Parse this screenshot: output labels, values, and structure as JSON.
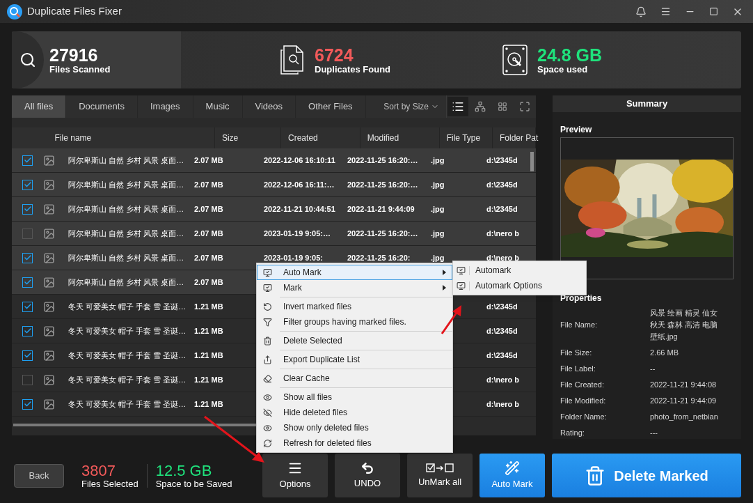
{
  "window": {
    "title": "Duplicate Files Fixer"
  },
  "stats": [
    {
      "kind": "scanned",
      "value": "27916",
      "label": "Files Scanned"
    },
    {
      "kind": "duplicates",
      "value": "6724",
      "label": "Duplicates Found"
    },
    {
      "kind": "space",
      "value": "24.8 GB",
      "label": "Space used"
    }
  ],
  "tabs": [
    {
      "label": "All files",
      "selected": true
    },
    {
      "label": "Documents",
      "selected": false
    },
    {
      "label": "Images",
      "selected": false
    },
    {
      "label": "Music",
      "selected": false
    },
    {
      "label": "Videos",
      "selected": false
    },
    {
      "label": "Other Files",
      "selected": false
    }
  ],
  "sort": {
    "label": "Sort by Size"
  },
  "view_modes": [
    {
      "kind": "list",
      "selected": true
    },
    {
      "kind": "tree",
      "selected": false
    },
    {
      "kind": "grid",
      "selected": false
    },
    {
      "kind": "expand",
      "selected": false
    }
  ],
  "table": {
    "columns": [
      "File name",
      "Size",
      "Created",
      "Modified",
      "File Type",
      "Folder Pat"
    ],
    "rows": [
      {
        "checked": true,
        "highlighted": true,
        "name": "阿尔卑斯山 自然 乡村 风景 桌面…",
        "size": "2.07 MB",
        "created": "2022-12-06 16:10:11",
        "modified": "2022-11-25 16:20:…",
        "type": ".jpg",
        "folder": "d:\\2345d"
      },
      {
        "checked": true,
        "highlighted": true,
        "name": "阿尔卑斯山 自然 乡村 风景 桌面…",
        "size": "2.07 MB",
        "created": "2022-12-06 16:11:…",
        "modified": "2022-11-25 16:20:…",
        "type": ".jpg",
        "folder": "d:\\2345d"
      },
      {
        "checked": true,
        "highlighted": true,
        "name": "阿尔卑斯山 自然 乡村 风景 桌面…",
        "size": "2.07 MB",
        "created": "2022-11-21 10:44:51",
        "modified": "2022-11-21 9:44:09",
        "type": ".jpg",
        "folder": "d:\\2345d"
      },
      {
        "checked": false,
        "highlighted": true,
        "name": "阿尔卑斯山 自然 乡村 风景 桌面…",
        "size": "2.07 MB",
        "created": "2023-01-19 9:05:…",
        "modified": "2022-11-25 16:20:…",
        "type": ".jpg",
        "folder": "d:\\nero b"
      },
      {
        "checked": true,
        "highlighted": true,
        "name": "阿尔卑斯山 自然 乡村 风景 桌面…",
        "size": "2.07 MB",
        "created": "2023-01-19 9:05:",
        "modified": "2022-11-25 16:20:",
        "type": ".jpg",
        "folder": "d:\\nero b"
      },
      {
        "checked": true,
        "highlighted": true,
        "name": "阿尔卑斯山 自然 乡村 风景 桌面…",
        "size": "2.07 MB"
      },
      {
        "checked": true,
        "highlighted": false,
        "name": "冬天 可爱美女 帽子 手套 雪 圣诞…",
        "size": "1.21 MB",
        "folder": "d:\\2345d"
      },
      {
        "checked": true,
        "highlighted": false,
        "name": "冬天 可爱美女 帽子 手套 雪 圣诞…",
        "size": "1.21 MB",
        "folder": "d:\\2345d"
      },
      {
        "checked": true,
        "highlighted": false,
        "name": "冬天 可爱美女 帽子 手套 雪 圣诞…",
        "size": "1.21 MB",
        "folder": "d:\\2345d"
      },
      {
        "checked": false,
        "highlighted": false,
        "name": "冬天 可爱美女 帽子 手套 雪 圣诞…",
        "size": "1.21 MB",
        "folder": "d:\\nero b"
      },
      {
        "checked": true,
        "highlighted": false,
        "name": "冬天 可爱美女 帽子 手套 雪 圣诞…",
        "size": "1.21 MB",
        "folder": "d:\\nero b"
      }
    ]
  },
  "summary": {
    "title": "Summary",
    "preview_label": "Preview",
    "properties_label": "Properties",
    "properties": [
      {
        "label": "File Name:",
        "value": "风景 绘画 精灵 仙女秋天 森林 高清 电脑壁纸.jpg"
      },
      {
        "label": "File Size:",
        "value": "2.66 MB"
      },
      {
        "label": "File Label:",
        "value": "--"
      },
      {
        "label": "File Created:",
        "value": "2022-11-21 9:44:08"
      },
      {
        "label": "File Modified:",
        "value": "2022-11-21 9:44:09"
      },
      {
        "label": "Folder Name:",
        "value": "photo_from_netbian"
      },
      {
        "label": "Rating:",
        "value": "---"
      }
    ]
  },
  "footer": {
    "back": "Back",
    "selected_count": "3807",
    "selected_label": "Files Selected",
    "saved_size": "12.5 GB",
    "saved_label": "Space to be Saved",
    "buttons": [
      {
        "kind": "options",
        "label": "Options"
      },
      {
        "kind": "undo",
        "label": "UNDO"
      },
      {
        "kind": "unmark",
        "label": "UnMark all"
      },
      {
        "kind": "automark",
        "label": "Auto Mark"
      },
      {
        "kind": "delete",
        "label": "Delete Marked"
      }
    ]
  },
  "context_menu": {
    "items": [
      {
        "kind": "submenu",
        "label": "Auto Mark",
        "highlighted": true
      },
      {
        "kind": "submenu",
        "label": "Mark",
        "highlighted": false
      },
      {
        "kind": "separator"
      },
      {
        "kind": "invert",
        "label": "Invert marked files",
        "highlighted": false
      },
      {
        "kind": "filter",
        "label": "Filter groups having marked files.",
        "highlighted": false
      },
      {
        "kind": "separator"
      },
      {
        "kind": "trash",
        "label": "Delete Selected",
        "highlighted": false
      },
      {
        "kind": "separator"
      },
      {
        "kind": "export",
        "label": "Export Duplicate List",
        "highlighted": false
      },
      {
        "kind": "separator"
      },
      {
        "kind": "eraser",
        "label": "Clear Cache",
        "highlighted": false
      },
      {
        "kind": "separator"
      },
      {
        "kind": "eye",
        "label": "Show all files",
        "highlighted": false
      },
      {
        "kind": "hide",
        "label": "Hide deleted files",
        "highlighted": false
      },
      {
        "kind": "eye",
        "label": "Show only deleted files",
        "highlighted": false
      },
      {
        "kind": "refresh",
        "label": "Refresh for deleted files",
        "highlighted": false
      }
    ],
    "submenu": [
      "Automark",
      "Automark Options"
    ]
  }
}
